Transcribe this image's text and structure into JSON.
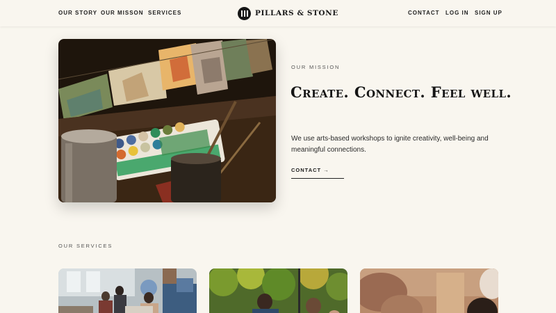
{
  "nav": {
    "left": [
      "OUR STORY",
      "OUR MISSON",
      "SERVICES"
    ],
    "brand": "PILLARS & STONE",
    "right": [
      "CONTACT",
      "LOG IN",
      "SIGN UP"
    ]
  },
  "hero": {
    "eyebrow": "OUR MISSION",
    "title": "Create. Connect. Feel well.",
    "body": "We use arts-based workshops to ignite creativity, well-being and meaningful connections.",
    "cta": "CONTACT",
    "cta_icon": "→",
    "image": "watercolor-paints-photo"
  },
  "services": {
    "eyebrow": "OUR SERVICES",
    "cards": [
      {
        "image": "workshop-room-photo"
      },
      {
        "image": "outdoor-group-photo"
      },
      {
        "image": "close-up-painting-photo"
      }
    ]
  },
  "colors": {
    "background": "#f9f6ef",
    "text": "#1c1c1c",
    "logo": "#161616"
  }
}
